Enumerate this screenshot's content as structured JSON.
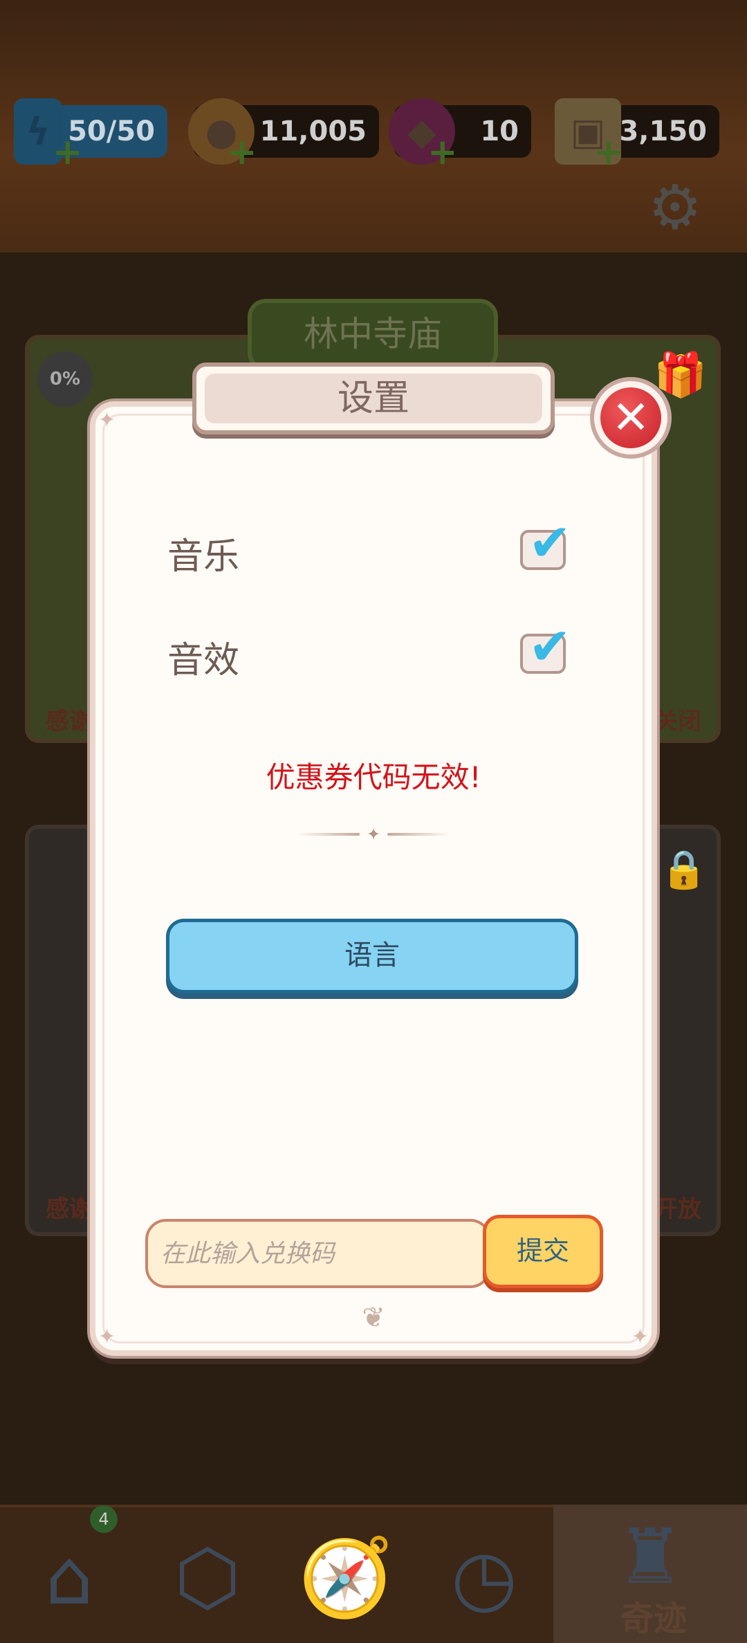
{
  "resources": {
    "energy": "50/50",
    "coins": "11,005",
    "gems": "10",
    "tickets": "3,150"
  },
  "background": {
    "card_title": "林中寺庙",
    "progress_percent": "0%",
    "card1_left_text": "感谢",
    "card1_right_text": "关闭",
    "card2_left_text": "感谢",
    "card2_right_text": "开放"
  },
  "nav": {
    "shop_badge": "4",
    "wonders_label": "奇迹"
  },
  "dialog": {
    "title": "设置",
    "music_label": "音乐",
    "music_enabled": true,
    "sfx_label": "音效",
    "sfx_enabled": true,
    "error_message": "优惠券代码无效!",
    "language_button": "语言",
    "code_placeholder": "在此输入兑换码",
    "submit_button": "提交"
  },
  "icons": {
    "close": "close-icon",
    "settings": "gear-icon",
    "check": "check-icon"
  }
}
